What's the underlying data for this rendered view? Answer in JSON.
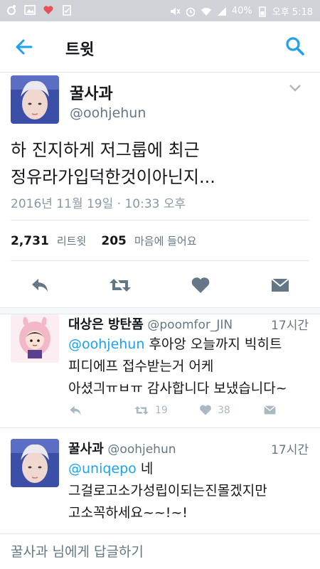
{
  "status_bar": {
    "battery": "40%",
    "time": "오후 5:18"
  },
  "app_bar": {
    "title": "트윗",
    "back_icon": "arrow-left-icon",
    "search_icon": "search-icon"
  },
  "main_tweet": {
    "name": "꿀사과",
    "handle": "@oohjehun",
    "text_line1": "하 진지하게 저그룹에 최근",
    "text_line2": "정유라가입덕한것이아닌지...",
    "timestamp": "2016년 11월 19일 · 10:33 오후",
    "retweet_count": "2,731",
    "retweet_label": "리트윗",
    "like_count": "205",
    "like_label": "마음에 들어요"
  },
  "replies": [
    {
      "name": "대상은 방탄폼",
      "handle": "@poomfor_JIN",
      "time": "17시간",
      "mention": "@oohjehun",
      "text_line1": " 후아앙 오늘까지 빅히트",
      "text_line2": "피디에프 접수받는거 어케",
      "text_line3": "아셨긔ㅠㅂㅠ 감사합니다 보냈습니다~",
      "retweets": "19",
      "likes": "38"
    },
    {
      "name": "꿀사과",
      "handle": "@oohjehun",
      "time": "17시간",
      "mention": "@uniqepo",
      "text_line1": " 네",
      "text_line2": "그걸로고소가성립이되는진몰겠지만",
      "text_line3": "고소꼭하세요~~!~!"
    }
  ],
  "reply_bar": {
    "placeholder": "꿀사과 님에게 답글하기"
  },
  "colors": {
    "accent": "#1da1f2",
    "secondary_text": "#657786",
    "divider": "#e1e8ed",
    "status_bar": "#cfd3d8"
  }
}
